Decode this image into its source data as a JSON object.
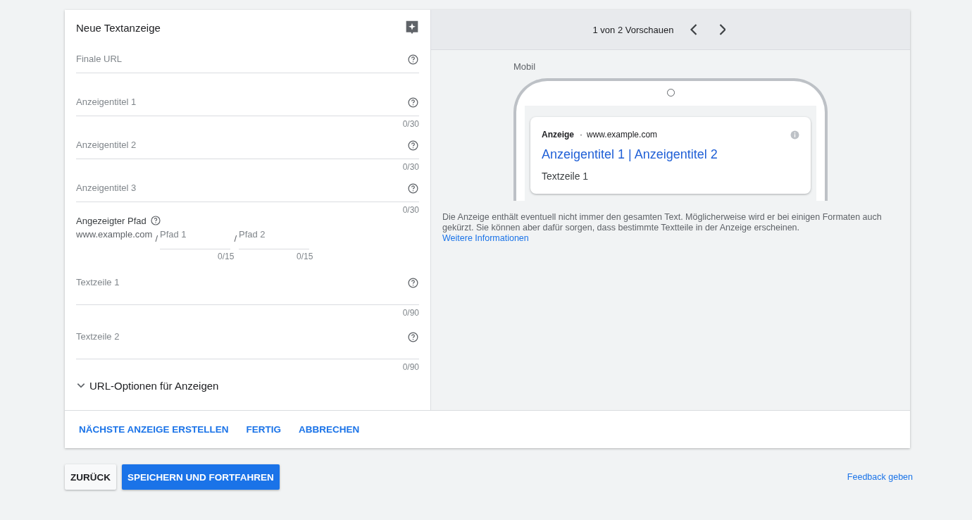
{
  "editor": {
    "title": "Neue Textanzeige",
    "fields": [
      {
        "kind": "line",
        "placeholder": "Finale URL"
      },
      {
        "kind": "line",
        "placeholder": "Anzeigentitel 1",
        "counter": "0/30"
      },
      {
        "kind": "line",
        "placeholder": "Anzeigentitel 2",
        "counter": "0/30"
      },
      {
        "kind": "line",
        "placeholder": "Anzeigentitel 3",
        "counter": "0/30"
      }
    ],
    "path": {
      "label": "Angezeigter Pfad",
      "domain": "www.example.com",
      "parts": [
        {
          "separator": "/",
          "placeholder": "Pfad 1",
          "counter": "0/15"
        },
        {
          "separator": "/",
          "placeholder": "Pfad 2",
          "counter": "0/15"
        }
      ]
    },
    "text_fields": [
      {
        "kind": "area",
        "placeholder": "Textzeile 1",
        "counter": "0/90"
      },
      {
        "kind": "area",
        "placeholder": "Textzeile 2",
        "counter": "0/90"
      }
    ],
    "url_options": {
      "label": "URL-Optionen für Anzeigen",
      "expanded": false
    }
  },
  "preview": {
    "pager": "1 von 2 Vorschauen",
    "device": "Mobil",
    "ad": {
      "badge": "Anzeige",
      "separator": "·",
      "url": "www.example.com",
      "headline": "Anzeigentitel 1 | Anzeigentitel 2",
      "description": "Textzeile 1"
    },
    "note": "Die Anzeige enthält eventuell nicht immer den gesamten Text. Möglicherweise wird er bei einigen Formaten auch gekürzt. Sie können aber dafür sorgen, dass bestimmte Textteile in der Anzeige erscheinen.",
    "note_link": "Weitere Informationen"
  },
  "card_actions": [
    "NÄCHSTE ANZEIGE ERSTELLEN",
    "FERTIG",
    "ABBRECHEN"
  ],
  "page_actions": [
    {
      "kind": "plain",
      "label": "ZURÜCK"
    },
    {
      "kind": "primary",
      "label": "SPEICHERN UND FORTFAHREN"
    }
  ],
  "feedback": "Feedback geben"
}
